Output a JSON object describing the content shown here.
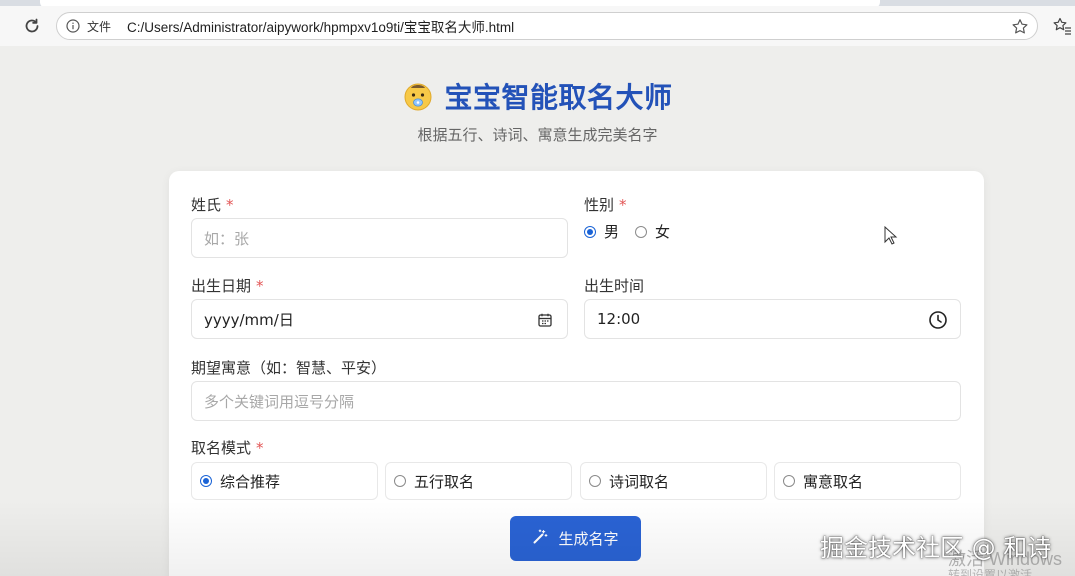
{
  "browser": {
    "file_label": "文件",
    "url": "C:/Users/Administrator/aipywork/hpmpxv1o9ti/宝宝取名大师.html",
    "icons": [
      "reload-icon",
      "info-icon",
      "star-icon",
      "favorites-icon"
    ]
  },
  "header": {
    "title": "宝宝智能取名大师",
    "subtitle": "根据五行、诗词、寓意生成完美名字",
    "icon": "baby-face-icon"
  },
  "form": {
    "surname": {
      "label": "姓氏",
      "required_mark": "*",
      "placeholder": "如：张"
    },
    "gender": {
      "label": "性别",
      "required_mark": "*",
      "options": [
        {
          "label": "男",
          "selected": true
        },
        {
          "label": "女",
          "selected": false
        }
      ]
    },
    "birth_date": {
      "label": "出生日期",
      "required_mark": "*",
      "value": "yyyy/mm/日",
      "icon": "calendar-icon"
    },
    "birth_time": {
      "label": "出生时间",
      "value": "12:00",
      "icon": "clock-icon"
    },
    "meaning": {
      "label": "期望寓意（如：智慧、平安）",
      "placeholder": "多个关键词用逗号分隔"
    },
    "mode": {
      "label": "取名模式",
      "required_mark": "*",
      "options": [
        {
          "label": "综合推荐",
          "selected": true
        },
        {
          "label": "五行取名",
          "selected": false
        },
        {
          "label": "诗词取名",
          "selected": false
        },
        {
          "label": "寓意取名",
          "selected": false
        }
      ]
    },
    "submit": {
      "label": "生成名字",
      "icon": "magic-wand-icon"
    }
  },
  "colors": {
    "accent": "#2a63d4",
    "title": "#2352b8",
    "required": "#e25555",
    "background": "#eeeeec"
  },
  "watermark": {
    "text": "掘金技术社区 @ 和诗",
    "activate": "激活 Windows",
    "activate_sub": "转到设置以激活 Windows。"
  }
}
